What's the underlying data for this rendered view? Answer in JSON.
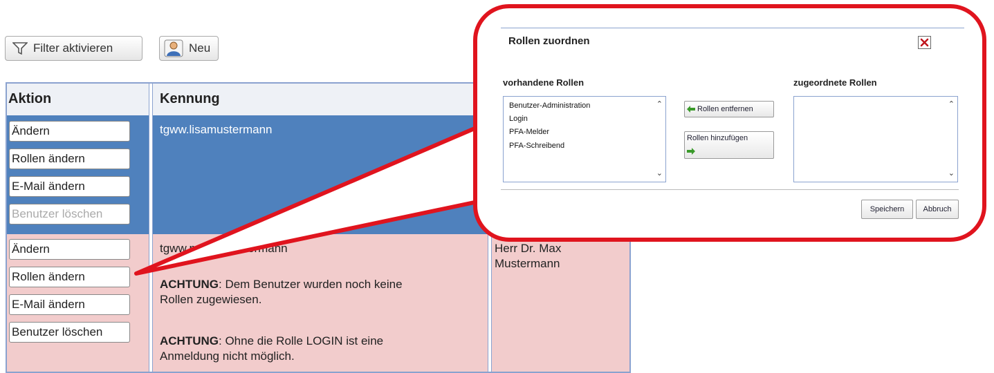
{
  "toolbar": {
    "filter_label": "Filter aktivieren",
    "new_label": "Neu"
  },
  "table": {
    "headers": {
      "action": "Aktion",
      "id": "Kennung"
    },
    "rows": [
      {
        "buttons": [
          "Ändern",
          "Rollen ändern",
          "E-Mail ändern",
          "Benutzer löschen"
        ],
        "id": "tgww.lisamustermann",
        "name": ""
      },
      {
        "buttons": [
          "Ändern",
          "Rollen ändern",
          "E-Mail ändern",
          "Benutzer löschen"
        ],
        "id_visible_start": "tgww.m",
        "id_visible_end": "ermann",
        "name_line1": "Herr Dr. Max",
        "name_line2": "Mustermann",
        "warn1_bold": "ACHTUNG",
        "warn1_line1": ": Dem Benutzer wurden noch keine",
        "warn1_line2": "Rollen zugewiesen.",
        "warn2_bold": "ACHTUNG",
        "warn2_line1": ": Ohne die Rolle LOGIN ist eine",
        "warn2_line2": "Anmeldung nicht möglich."
      }
    ]
  },
  "dialog": {
    "title": "Rollen zuordnen",
    "available_label": "vorhandene Rollen",
    "assigned_label": "zugeordnete Rollen",
    "available_roles": [
      "Benutzer-Administration",
      "Login",
      "PFA-Melder",
      "PFA-Schreibend"
    ],
    "assigned_roles": [],
    "remove_label": "Rollen entfernen",
    "add_label": "Rollen hinzufügen",
    "save_label": "Speichern",
    "cancel_label": "Abbruch"
  },
  "colors": {
    "highlight_red": "#e0141e",
    "row_selected": "#4f81bd",
    "row_warning": "#f2cccc",
    "arrow_green": "#3a9a2a"
  }
}
